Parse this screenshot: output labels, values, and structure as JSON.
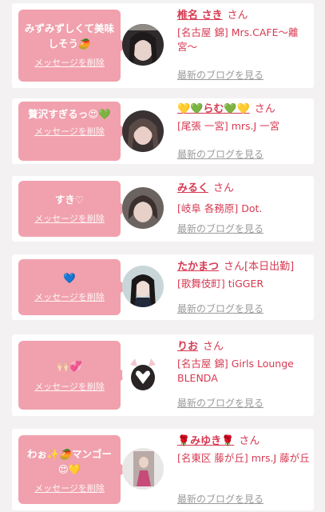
{
  "cards": [
    {
      "message": "みずみずしくて美味しそう🥭",
      "delete_label": "メッセージを削除",
      "name": "椎名 さき",
      "san": "さん",
      "shop": "[名古屋 錦] Mrs.CAFE〜離宮〜",
      "blog_label": "最新のブログを見る"
    },
    {
      "message": "贅沢すぎるっ😍💚",
      "delete_label": "メッセージを削除",
      "name": "💛💚らむ💚💛",
      "san": "さん",
      "shop": "[尾張 一宮] mrs.J 一宮",
      "blog_label": "最新のブログを見る"
    },
    {
      "message": "すき♡",
      "delete_label": "メッセージを削除",
      "name": "みるく",
      "san": "さん",
      "shop": "[岐阜 各務原] Dot.",
      "blog_label": "最新のブログを見る"
    },
    {
      "message": "💙",
      "delete_label": "メッセージを削除",
      "name": "たかまつ",
      "san": "さん[本日出勤]",
      "shop": "[歌舞伎町] tiGGER",
      "blog_label": "最新のブログを見る"
    },
    {
      "message": "🙌🏻💞",
      "delete_label": "メッセージを削除",
      "name": "りお",
      "san": "さん",
      "shop": "[名古屋 錦] Girls Lounge BLENDA",
      "blog_label": "最新のブログを見る"
    },
    {
      "message": "わぉ✨🥭マンゴー😍💛",
      "delete_label": "メッセージを削除",
      "name": "🌹みゆき🌹",
      "san": "さん",
      "shop": "[名東区 藤が丘] mrs.J 藤が丘",
      "blog_label": "最新のブログを見る"
    }
  ]
}
